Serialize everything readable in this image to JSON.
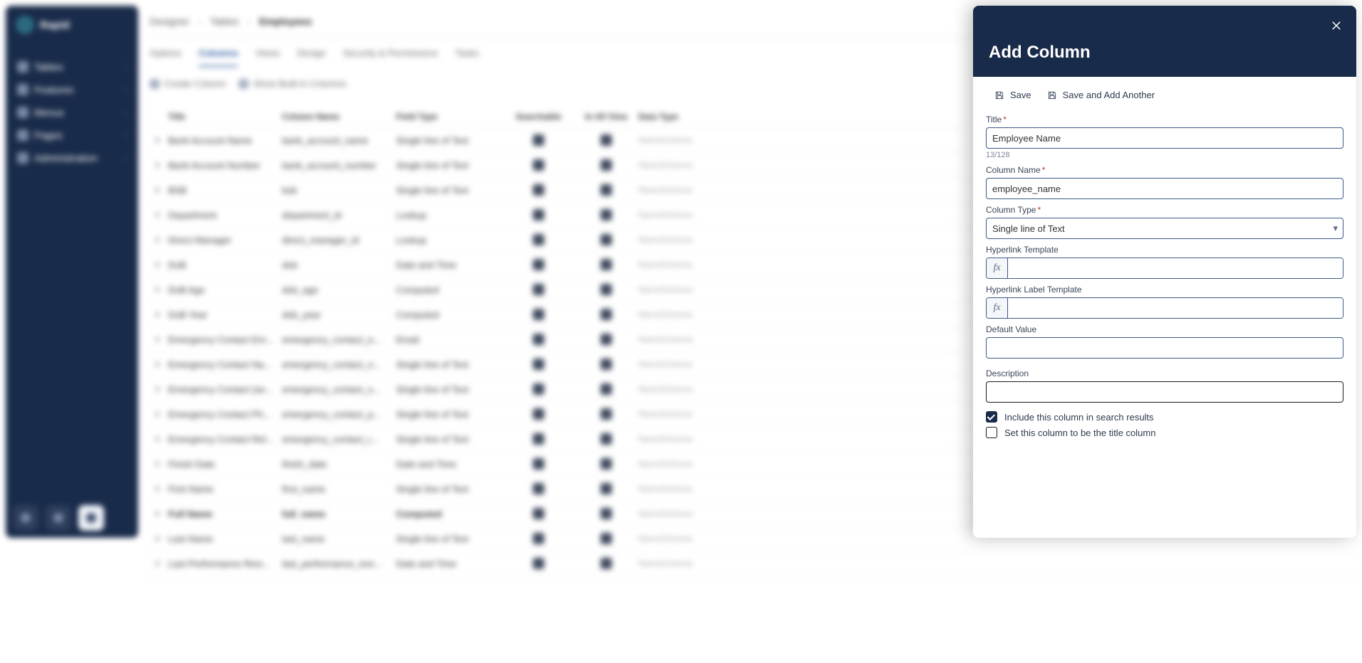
{
  "brand": "Rapid",
  "sidebar": {
    "items": [
      {
        "label": "Tables"
      },
      {
        "label": "Features"
      },
      {
        "label": "Menus"
      },
      {
        "label": "Pages"
      },
      {
        "label": "Administration"
      }
    ]
  },
  "breadcrumb": [
    "Designer",
    "Tables",
    "Employees"
  ],
  "tabs": [
    "Options",
    "Columns",
    "Views",
    "Design",
    "Security & Permissions",
    "Tasks"
  ],
  "tabs_active_index": 1,
  "toolbar": {
    "create_label": "Create Column",
    "show_builtin_label": "Show Built-in Columns"
  },
  "columns_header": {
    "title": "Title",
    "column_name": "Column Name",
    "field_type": "Field Type",
    "searchable": "Searchable",
    "in_all_view": "In All View",
    "data_type": "Data Type"
  },
  "rows": [
    {
      "title": "Bank Account Name",
      "cname": "bank_account_name",
      "ftype": "Single line of Text",
      "dtype": "NameSchema"
    },
    {
      "title": "Bank Account Number",
      "cname": "bank_account_number",
      "ftype": "Single line of Text",
      "dtype": "NameSchema"
    },
    {
      "title": "BSB",
      "cname": "bsb",
      "ftype": "Single line of Text",
      "dtype": "NameSchema"
    },
    {
      "title": "Department",
      "cname": "department_id",
      "ftype": "Lookup",
      "dtype": "NameSchema"
    },
    {
      "title": "Direct Manager",
      "cname": "direct_manager_id",
      "ftype": "Lookup",
      "dtype": "NameSchema"
    },
    {
      "title": "DoB",
      "cname": "dob",
      "ftype": "Date and Time",
      "dtype": "NameSchema"
    },
    {
      "title": "DoB Age",
      "cname": "dob_age",
      "ftype": "Computed",
      "dtype": "NameSchema"
    },
    {
      "title": "DoB Year",
      "cname": "dob_year",
      "ftype": "Computed",
      "dtype": "NameSchema"
    },
    {
      "title": "Emergency Contact Em...",
      "cname": "emergency_contact_e...",
      "ftype": "Email",
      "dtype": "NameSchema"
    },
    {
      "title": "Emergency Contact Na...",
      "cname": "emergency_contact_n...",
      "ftype": "Single line of Text",
      "dtype": "NameSchema"
    },
    {
      "title": "Emergency Contact (se...",
      "cname": "emergency_contact_s...",
      "ftype": "Single line of Text",
      "dtype": "NameSchema"
    },
    {
      "title": "Emergency Contact Ph...",
      "cname": "emergency_contact_p...",
      "ftype": "Single line of Text",
      "dtype": "NameSchema"
    },
    {
      "title": "Emergency Contact Rel...",
      "cname": "emergency_contact_r...",
      "ftype": "Single line of Text",
      "dtype": "NameSchema"
    },
    {
      "title": "Finish Date",
      "cname": "finish_date",
      "ftype": "Date and Time",
      "dtype": "NameSchema"
    },
    {
      "title": "First Name",
      "cname": "first_name",
      "ftype": "Single line of Text",
      "dtype": "NameSchema"
    },
    {
      "title": "Full Name",
      "cname": "full_name",
      "ftype": "Computed",
      "dtype": "NameSchema",
      "bold": true
    },
    {
      "title": "Last Name",
      "cname": "last_name",
      "ftype": "Single line of Text",
      "dtype": "NameSchema"
    },
    {
      "title": "Last Performance Revi...",
      "cname": "last_performance_revi...",
      "ftype": "Date and Time",
      "dtype": "NameSchema"
    }
  ],
  "panel": {
    "title": "Add Column",
    "actions": {
      "save": "Save",
      "save_another": "Save and Add Another"
    },
    "labels": {
      "title": "Title",
      "column_name": "Column Name",
      "column_type": "Column Type",
      "hyperlink_template": "Hyperlink Template",
      "hyperlink_label": "Hyperlink Label Template",
      "default_value": "Default Value",
      "description": "Description"
    },
    "values": {
      "title": "Employee Name",
      "title_counter": "13/128",
      "column_name": "employee_name",
      "column_type": "Single line of Text",
      "hyperlink_template": "",
      "hyperlink_label": "",
      "default_value": "",
      "description": ""
    },
    "checkboxes": {
      "include_search": {
        "label": "Include this column in search results",
        "checked": true
      },
      "title_column": {
        "label": "Set this column to be the title column",
        "checked": false
      }
    },
    "fx_glyph": "fx"
  }
}
